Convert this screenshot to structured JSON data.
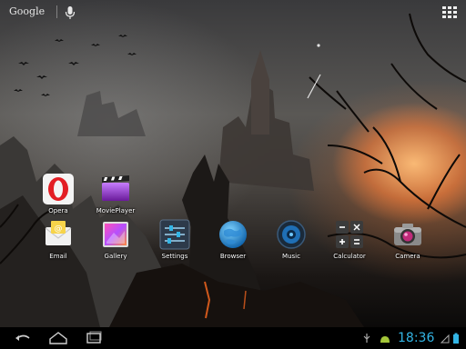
{
  "search": {
    "label": "Google",
    "mic_icon": "microphone-icon"
  },
  "apps_button_icon": "all-apps-grid-icon",
  "apps": [
    {
      "label": "Opera",
      "icon": "opera-icon"
    },
    {
      "label": "MoviePlayer",
      "icon": "movieplayer-icon"
    },
    {
      "label": "Email",
      "icon": "email-icon"
    },
    {
      "label": "Gallery",
      "icon": "gallery-icon"
    },
    {
      "label": "Settings",
      "icon": "settings-icon"
    },
    {
      "label": "Browser",
      "icon": "browser-globe-icon"
    },
    {
      "label": "Music",
      "icon": "music-speaker-icon"
    },
    {
      "label": "Calculator",
      "icon": "calculator-icon"
    },
    {
      "label": "Camera",
      "icon": "camera-icon"
    }
  ],
  "navbar": {
    "back_icon": "back-icon",
    "home_icon": "home-icon",
    "recents_icon": "recent-apps-icon",
    "time": "18:36",
    "accent_color": "#33b5e5"
  }
}
